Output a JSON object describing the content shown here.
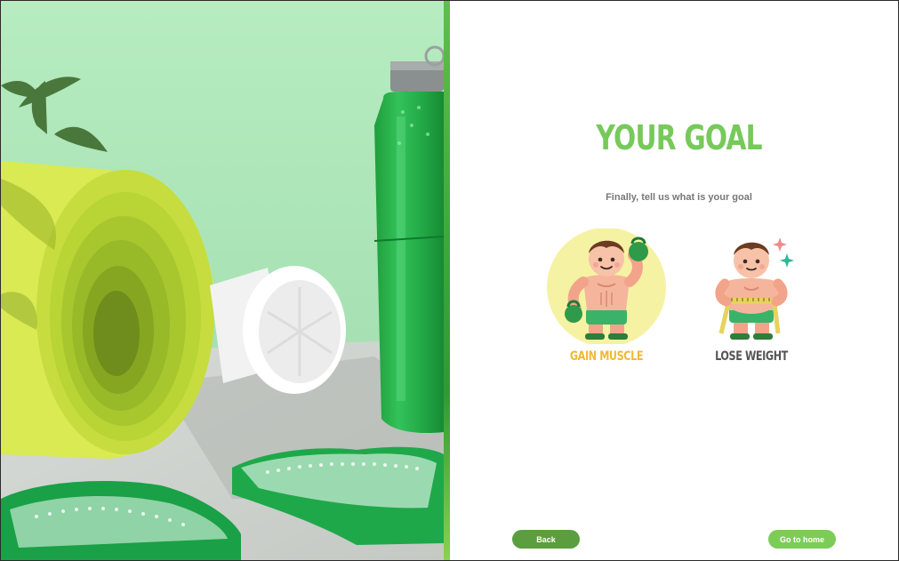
{
  "photo": {
    "alt": "fitness-equipment-photo"
  },
  "header": {
    "title": "YOUR GOAL",
    "subtitle": "Finally, tell us what is your goal"
  },
  "goals": [
    {
      "id": "gain-muscle",
      "label": "GAIN MUSCLE",
      "icon": "muscle-man-kettlebell-icon",
      "highlighted": true
    },
    {
      "id": "lose-weight",
      "label": "LOSE WEIGHT",
      "icon": "man-measuring-tape-icon",
      "highlighted": false
    }
  ],
  "footer": {
    "back_label": "Back",
    "home_label": "Go to home"
  },
  "colors": {
    "title": "#77c95a",
    "gain_label": "#f3b833",
    "lose_label": "#555555",
    "back_button": "#5a9e3f",
    "home_button": "#7ccc58",
    "photo_bg": "#b8ecc2"
  }
}
